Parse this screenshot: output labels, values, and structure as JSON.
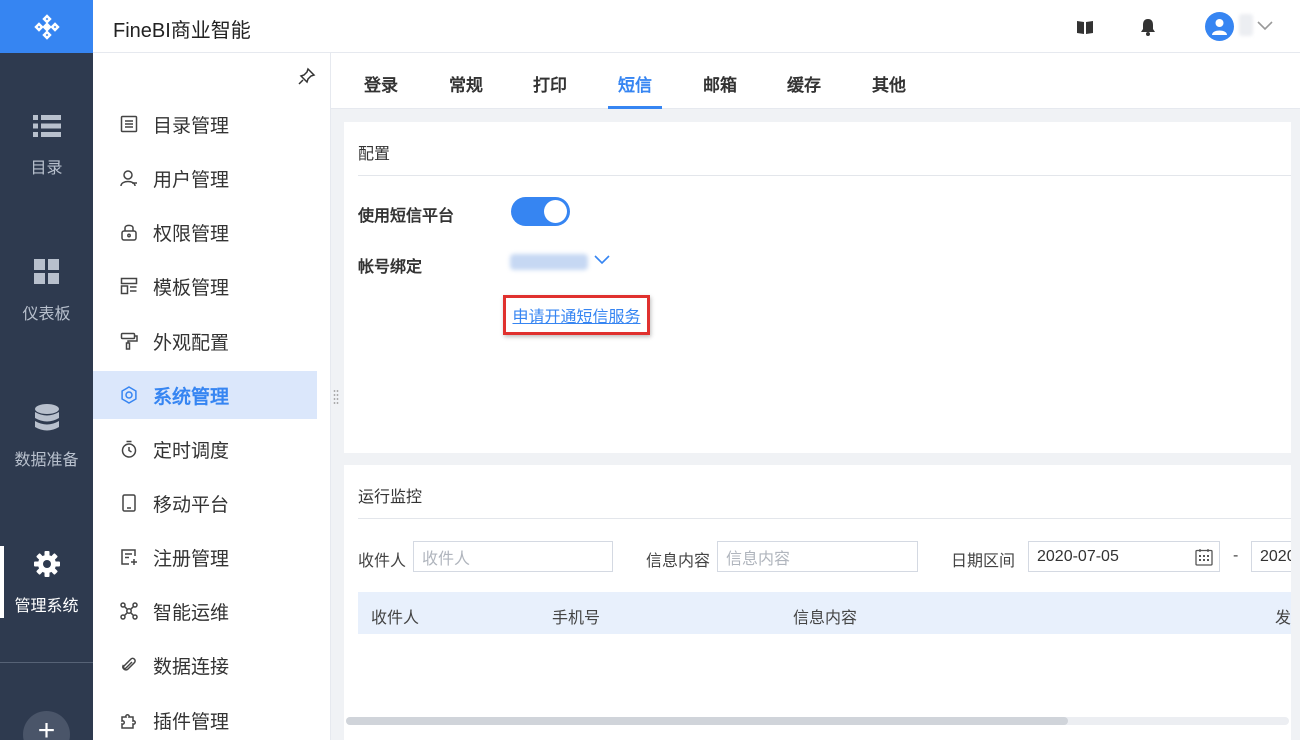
{
  "app": {
    "title": "FineBI商业智能"
  },
  "rail": {
    "items": [
      {
        "label": "目录",
        "icon": "list-icon"
      },
      {
        "label": "仪表板",
        "icon": "dashboard-icon"
      },
      {
        "label": "数据准备",
        "icon": "database-icon"
      },
      {
        "label": "管理系统",
        "icon": "gear-icon",
        "active": true
      }
    ],
    "add_label": "+"
  },
  "menu": {
    "items": [
      {
        "label": "目录管理",
        "icon": "catalog-icon"
      },
      {
        "label": "用户管理",
        "icon": "user-icon"
      },
      {
        "label": "权限管理",
        "icon": "lock-icon"
      },
      {
        "label": "模板管理",
        "icon": "template-icon"
      },
      {
        "label": "外观配置",
        "icon": "brush-icon"
      },
      {
        "label": "系统管理",
        "icon": "settings-icon",
        "active": true
      },
      {
        "label": "定时调度",
        "icon": "timer-icon"
      },
      {
        "label": "移动平台",
        "icon": "tablet-icon"
      },
      {
        "label": "注册管理",
        "icon": "register-icon"
      },
      {
        "label": "智能运维",
        "icon": "ops-icon"
      },
      {
        "label": "数据连接",
        "icon": "link-icon"
      },
      {
        "label": "插件管理",
        "icon": "plugin-icon"
      }
    ]
  },
  "tabs": [
    {
      "label": "登录"
    },
    {
      "label": "常规"
    },
    {
      "label": "打印"
    },
    {
      "label": "短信",
      "active": true
    },
    {
      "label": "邮箱"
    },
    {
      "label": "缓存"
    },
    {
      "label": "其他"
    }
  ],
  "config": {
    "title": "配置",
    "sms_platform_label": "使用短信平台",
    "sms_platform_enabled": true,
    "account_label": "帐号绑定",
    "apply_link": "申请开通短信服务"
  },
  "monitor": {
    "title": "运行监控",
    "filters": {
      "receiver_label": "收件人",
      "receiver_placeholder": "收件人",
      "content_label": "信息内容",
      "content_placeholder": "信息内容",
      "date_label": "日期区间",
      "date_from": "2020-07-05",
      "date_sep": "-",
      "date_to": "2020"
    },
    "columns": [
      "收件人",
      "手机号",
      "信息内容",
      "发"
    ]
  },
  "colors": {
    "accent": "#3685f2",
    "rail_bg": "#2e3a4f",
    "highlight_border": "#e0312e"
  }
}
